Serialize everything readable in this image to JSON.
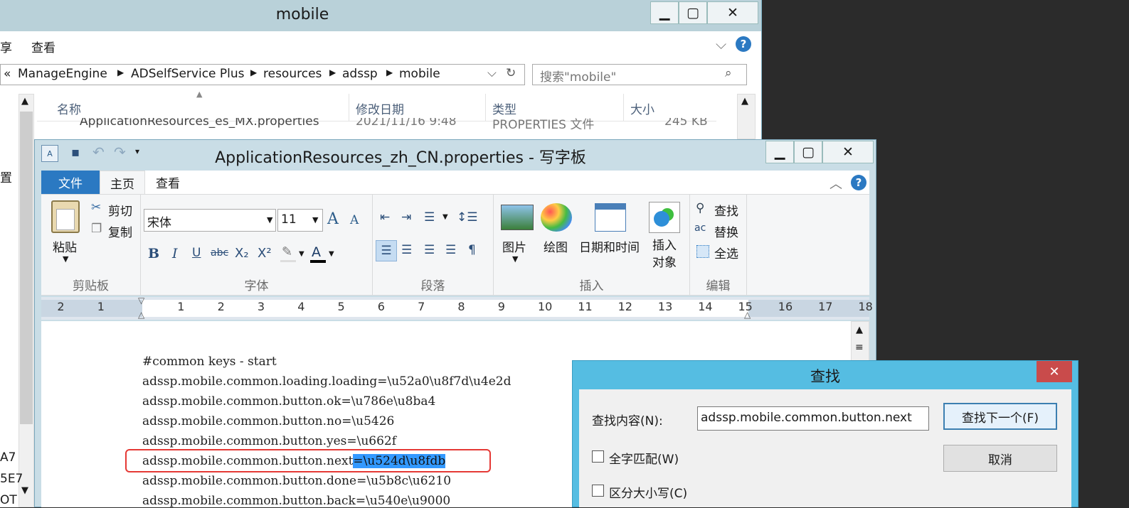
{
  "explorer": {
    "title": "mobile",
    "menu": [
      "享",
      "查看"
    ],
    "breadcrumb": [
      "«",
      "ManageEngine",
      "ADSelfService Plus",
      "resources",
      "adssp",
      "mobile"
    ],
    "search_placeholder": "搜索\"mobile\"",
    "columns": [
      "名称",
      "修改日期",
      "类型",
      "大小"
    ],
    "row_partial": {
      "name": "ApplicationResources_es_MX.properties",
      "date": "2021/11/16 9:48",
      "type": "PROPERTIES 文件",
      "size": "245 KB"
    },
    "left_fragments": [
      "置",
      "A7",
      "5E7",
      "OT"
    ]
  },
  "wordpad": {
    "title": "ApplicationResources_zh_CN.properties - 写字板",
    "tabs": [
      "文件",
      "主页",
      "查看"
    ],
    "clipboard": {
      "paste": "粘贴",
      "cut": "剪切",
      "copy": "复制",
      "label": "剪贴板"
    },
    "font": {
      "family": "宋体",
      "size": "11",
      "label": "字体"
    },
    "paragraph_label": "段落",
    "insert": {
      "picture": "图片",
      "paint": "绘图",
      "datetime": "日期和时间",
      "object": "插入对象",
      "label": "插入"
    },
    "edit": {
      "find": "查找",
      "replace": "替换",
      "selectall": "全选",
      "label": "编辑"
    },
    "ruler_ticks": [
      "2",
      "1",
      "1",
      "2",
      "3",
      "4",
      "5",
      "6",
      "7",
      "8",
      "9",
      "10",
      "11",
      "12",
      "13",
      "14",
      "15",
      "16",
      "17",
      "18"
    ],
    "lines": [
      "#common keys - start",
      "adssp.mobile.common.loading.loading=\\u52a0\\u8f7d\\u4e2d",
      "adssp.mobile.common.button.ok=\\u786e\\u8ba4",
      "adssp.mobile.common.button.no=\\u5426",
      "adssp.mobile.common.button.yes=\\u662f",
      "adssp.mobile.common.button.next",
      "adssp.mobile.common.button.done=\\u5b8c\\u6210",
      "adssp.mobile.common.button.back=\\u540e\\u9000"
    ],
    "highlight": "=\\u524d\\u8fdb"
  },
  "find": {
    "title": "查找",
    "label": "查找内容(N):",
    "value": "adssp.mobile.common.button.next",
    "find_next": "查找下一个(F)",
    "cancel": "取消",
    "whole_word": "全字匹配(W)",
    "match_case": "区分大小写(C)"
  },
  "colors": {
    "accent": "#2b79c2",
    "titlebar": "#b9d1d9",
    "dialog": "#55bde2",
    "highlight": "#3399ff",
    "mark": "#e53935"
  }
}
